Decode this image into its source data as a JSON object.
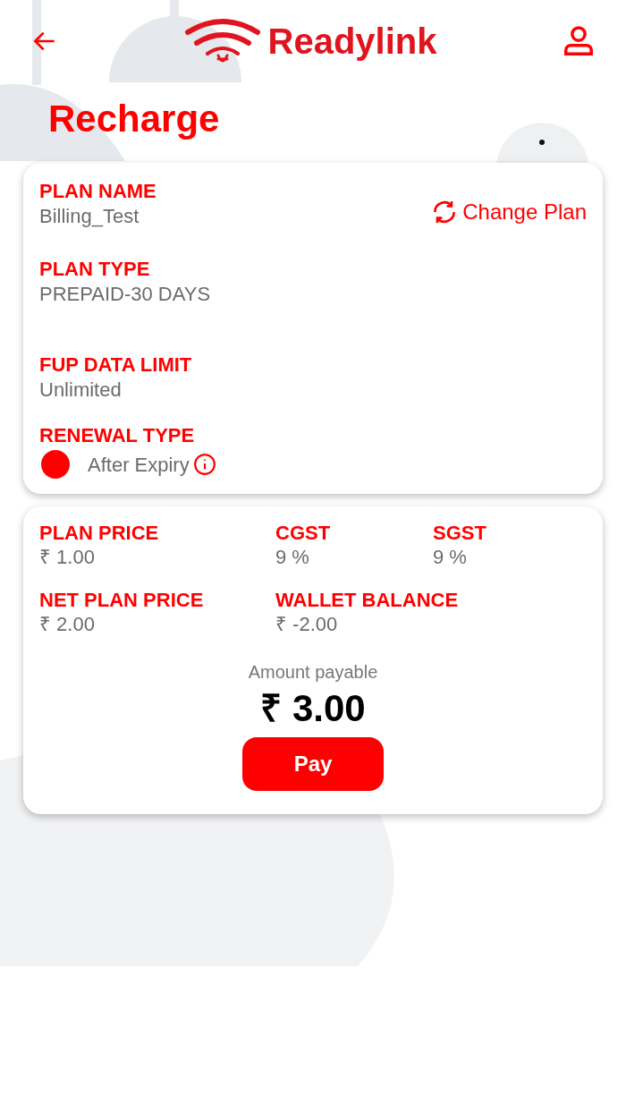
{
  "header": {
    "brand": "Readylink"
  },
  "title": "Recharge",
  "plan_card": {
    "plan_name_label": "PLAN NAME",
    "plan_name": "Billing_Test",
    "change_plan": "Change Plan",
    "plan_type_label": "PLAN TYPE",
    "plan_type": "PREPAID-30 DAYS",
    "fup_label": "FUP DATA LIMIT",
    "fup": "Unlimited",
    "renewal_label": "RENEWAL TYPE",
    "renewal_options": [
      {
        "label": "After Expiry",
        "selected": true
      }
    ]
  },
  "price_card": {
    "fields": [
      {
        "label": "PLAN PRICE",
        "value": "₹ 1.00"
      },
      {
        "label": "CGST",
        "value": "9 %"
      },
      {
        "label": "SGST",
        "value": "9 %"
      },
      {
        "label": "NET PLAN PRICE",
        "value": "₹ 2.00"
      },
      {
        "label": "WALLET BALANCE",
        "value": "₹ -2.00"
      }
    ],
    "amount_label": "Amount payable",
    "amount": "₹ 3.00",
    "pay_button": "Pay"
  }
}
